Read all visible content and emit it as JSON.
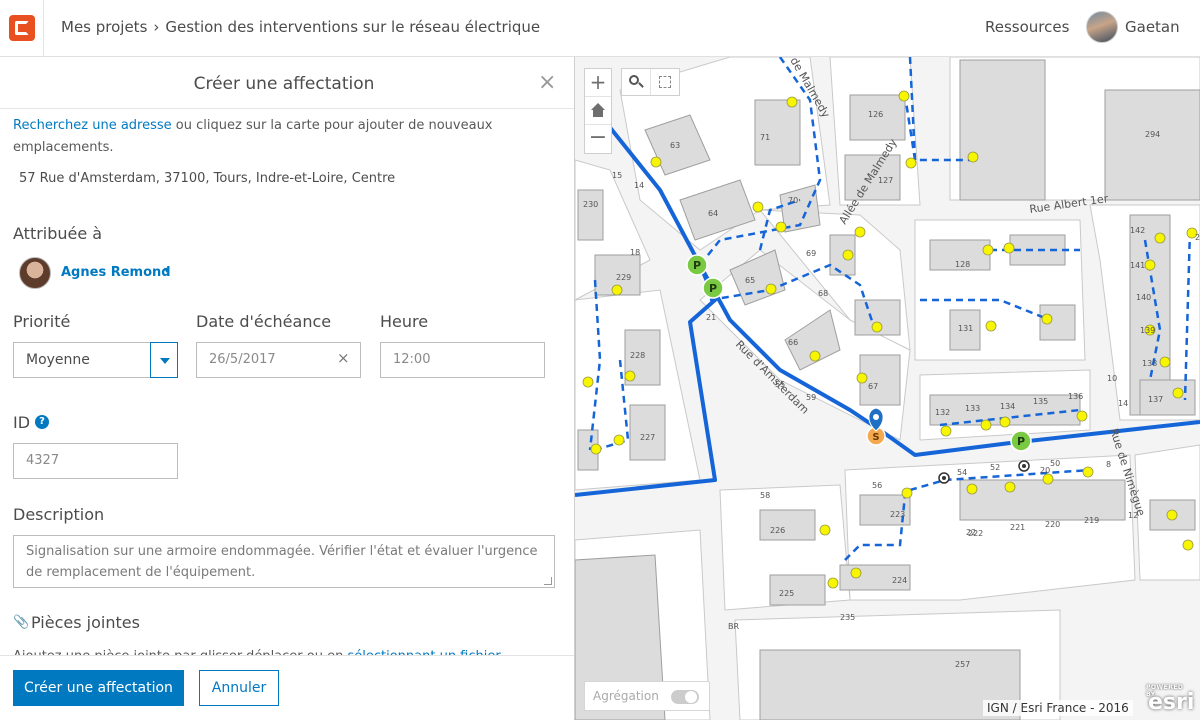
{
  "header": {
    "breadcrumb": [
      "Mes projets",
      "Gestion des interventions sur le réseau électrique"
    ],
    "breadcrumb_separator": "›",
    "resources_label": "Ressources",
    "user_name": "Gaetan",
    "logo_color": "#e8501f"
  },
  "panel": {
    "title": "Créer une affectation",
    "close_icon": "×",
    "intro_link": "Recherchez une adresse",
    "intro_text": " ou cliquez sur la carte pour ajouter de nouveaux emplacements.",
    "address": "57 Rue d'Amsterdam, 37100, Tours, Indre-et-Loire, Centre",
    "assigned_label": "Attribuée à",
    "assignee_name": "Agnes Remond",
    "assignee_caret": "▾",
    "priority_label": "Priorité",
    "priority_value": "Moyenne",
    "due_date_label": "Date d'échéance",
    "due_date_value": "26/5/2017",
    "date_clear_icon": "×",
    "time_label": "Heure",
    "time_value": "12:00",
    "id_label": "ID",
    "id_help": "?",
    "id_value": "4327",
    "description_label": "Description",
    "description_value": "Signalisation sur une armoire endommagée. Vérifier l'état et évaluer l'urgence de remplacement de l'équipement.",
    "attachments_icon": "📎",
    "attachments_label": "Pièces jointes",
    "attachments_hint": "Ajoutez une pièce jointe par glisser-déplacer ou en ",
    "attachments_hint_link": "sélectionnant un fichier",
    "create_button": "Créer une affectation",
    "cancel_button": "Annuler",
    "accent_color": "#0079c1"
  },
  "map": {
    "zoom_in": "+",
    "zoom_out": "−",
    "aggregation_label": "Agrégation",
    "aggregation_on": false,
    "attribution": "IGN / Esri France - 2016",
    "esri_powered": "POWERED BY",
    "esri_name": "esri",
    "street_labels": [
      "Rue d'Amsterdam",
      "Allée de Malmedy",
      "Rue Albert 1er",
      "Rue de Nimègue",
      "de Malmedy"
    ],
    "parcel_labels": [
      "294",
      "126",
      "127",
      "63",
      "71",
      "64",
      "70",
      "69",
      "128",
      "65",
      "68",
      "131",
      "66",
      "67",
      "229",
      "230",
      "228",
      "227",
      "142",
      "141",
      "140",
      "139",
      "138",
      "137",
      "132",
      "133",
      "134",
      "135",
      "136",
      "223",
      "222",
      "221",
      "220",
      "219",
      "226",
      "224",
      "225",
      "257",
      "235",
      "2",
      "18",
      "20",
      "22",
      "15",
      "14",
      "21",
      "55",
      "59",
      "56",
      "54",
      "52",
      "50",
      "58",
      "8",
      "10",
      "12",
      "14",
      "BR"
    ],
    "network_color": "#1565d8",
    "node_color": "#f7f500",
    "parking_color": "#7ac943",
    "parking_label": "P",
    "pin_label": "S"
  }
}
